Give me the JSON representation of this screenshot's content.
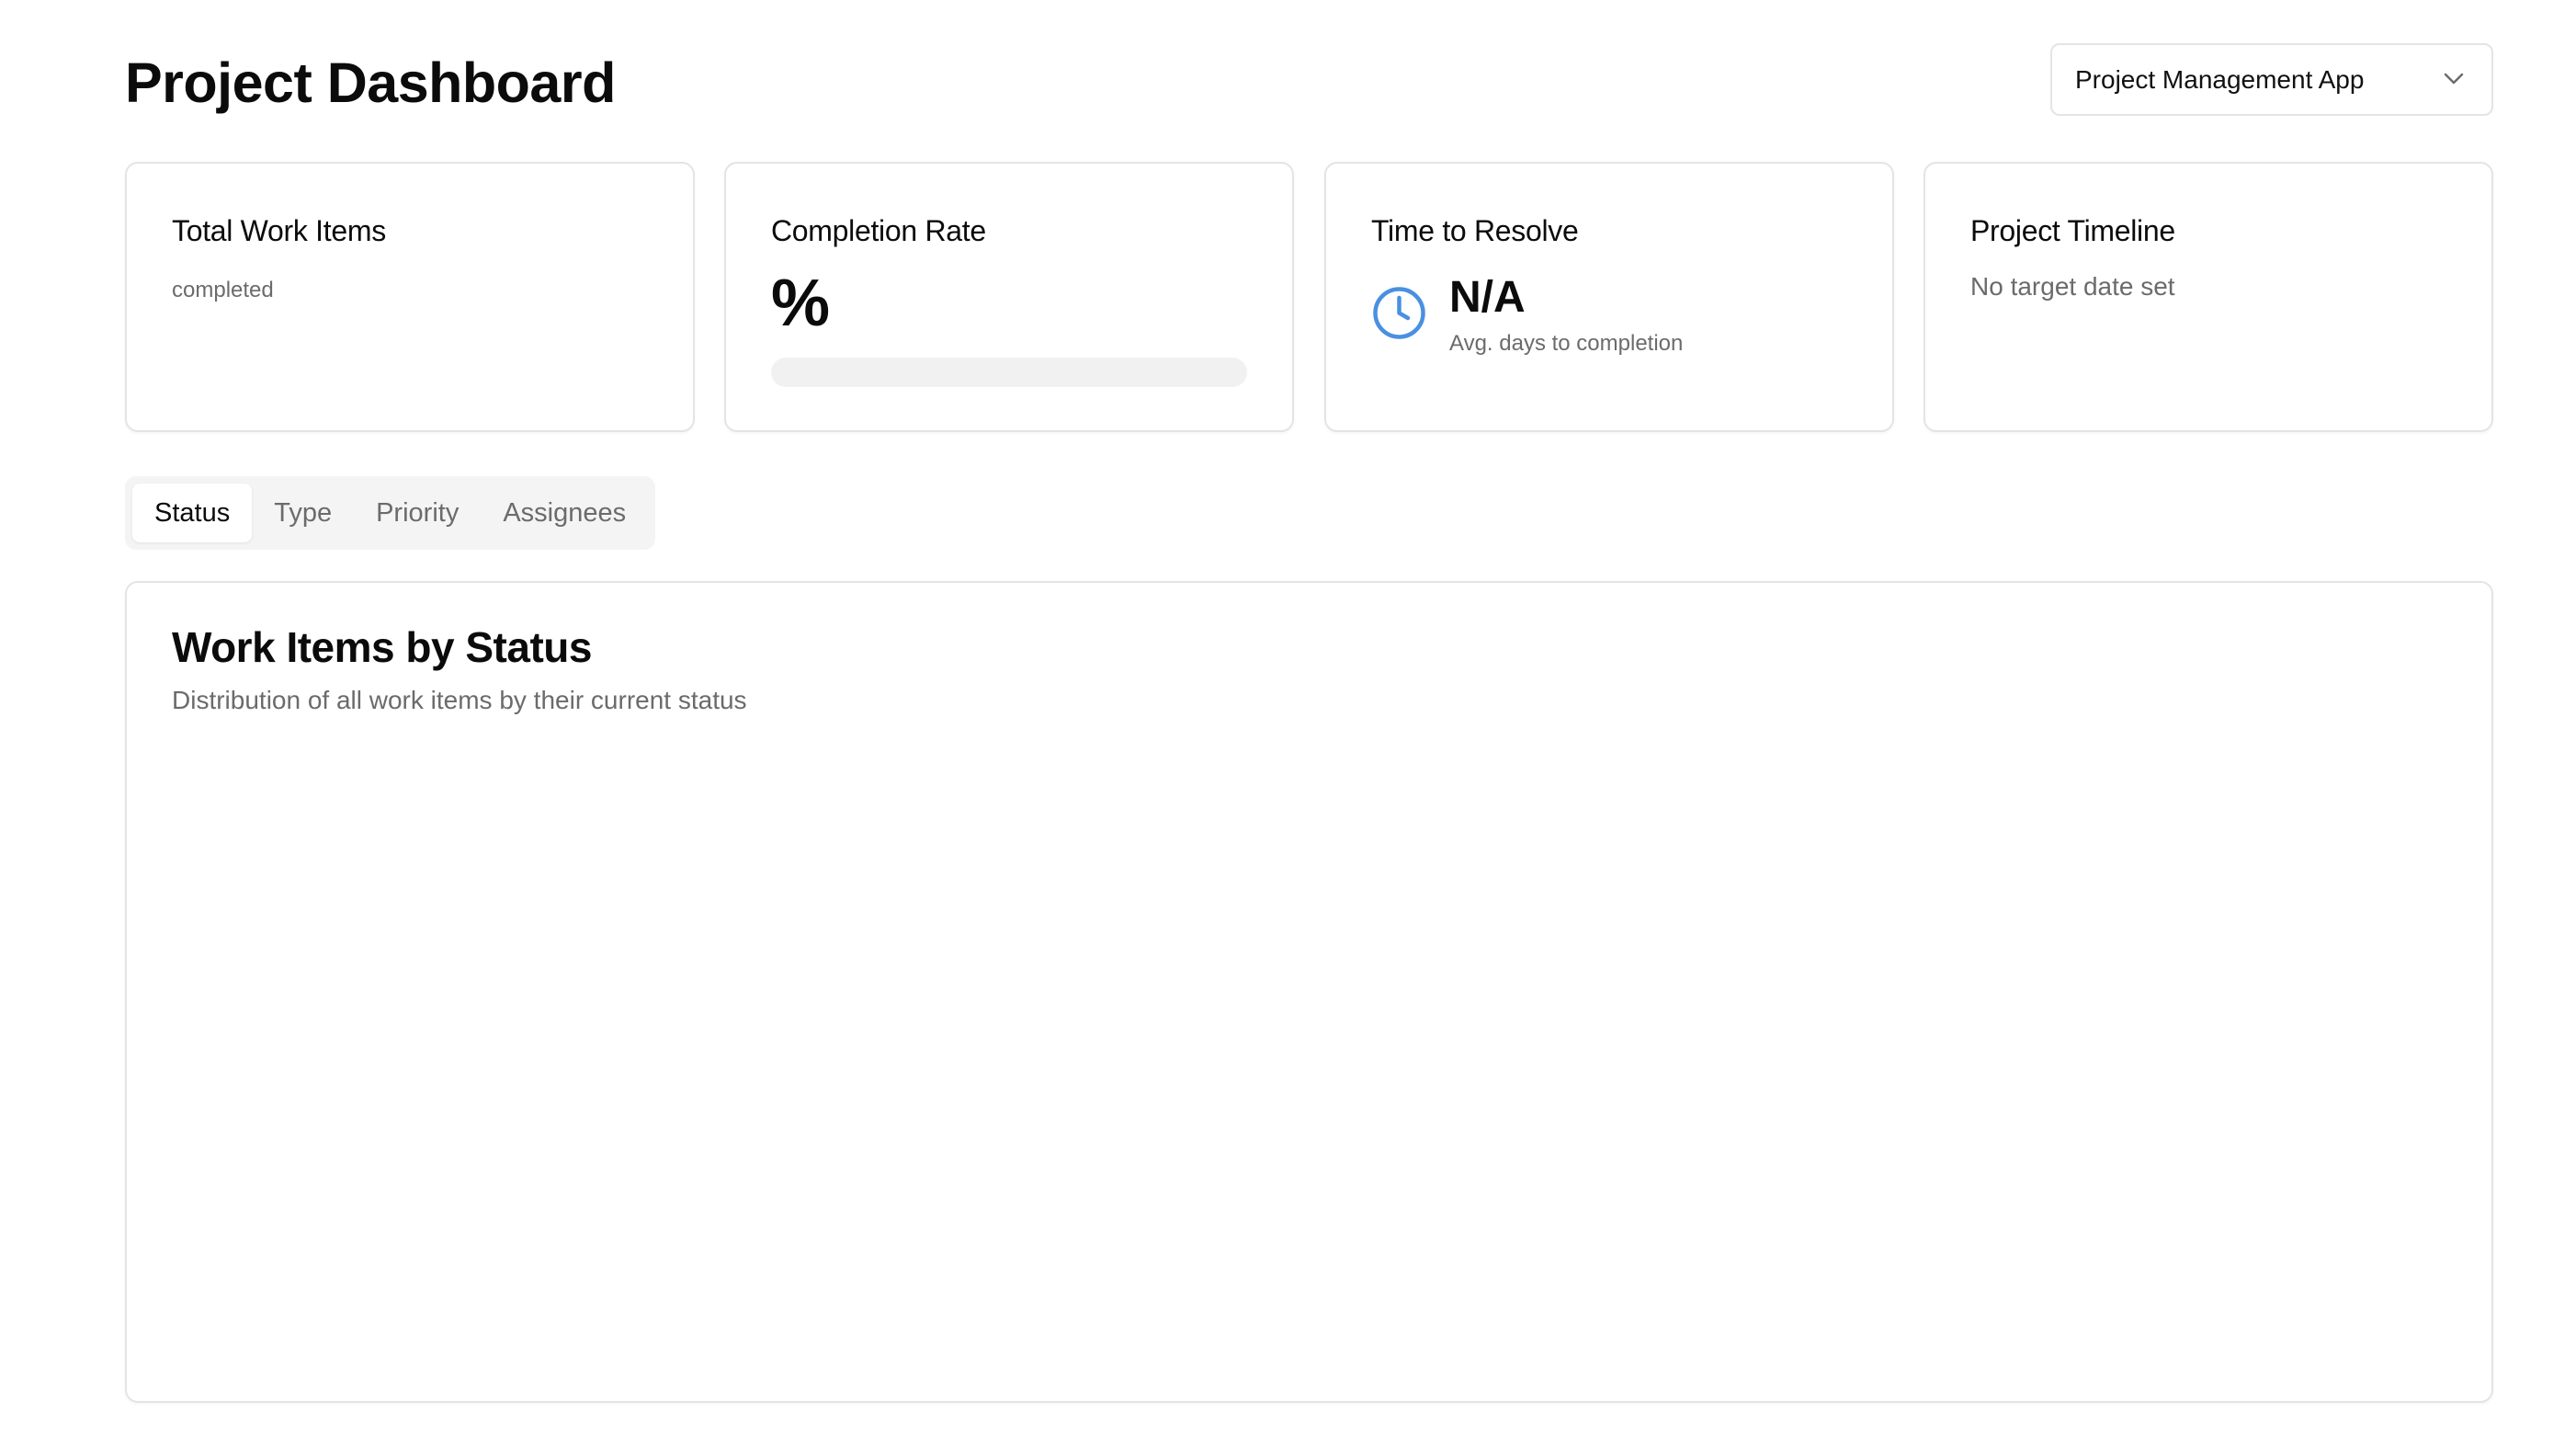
{
  "header": {
    "title": "Project Dashboard",
    "project_select": {
      "value": "Project Management App",
      "icon": "chevron-down-icon"
    }
  },
  "cards": {
    "total_work_items": {
      "title": "Total Work Items",
      "caption": "completed"
    },
    "completion_rate": {
      "title": "Completion Rate",
      "value": "%",
      "progress_fraction": 0
    },
    "time_to_resolve": {
      "title": "Time to Resolve",
      "icon": "clock-icon",
      "value": "N/A",
      "caption": "Avg. days to completion"
    },
    "project_timeline": {
      "title": "Project Timeline",
      "text": "No target date set"
    }
  },
  "tabs": [
    {
      "label": "Status",
      "active": true
    },
    {
      "label": "Type",
      "active": false
    },
    {
      "label": "Priority",
      "active": false
    },
    {
      "label": "Assignees",
      "active": false
    }
  ],
  "chart_card": {
    "title": "Work Items by Status",
    "subtitle": "Distribution of all work items by their current status"
  },
  "colors": {
    "accent_blue": "#4a90e2",
    "border": "#e4e4e7",
    "muted_text": "#6b6b6b",
    "tab_bg": "#f4f4f5",
    "progress_track": "#f1f1f2"
  }
}
